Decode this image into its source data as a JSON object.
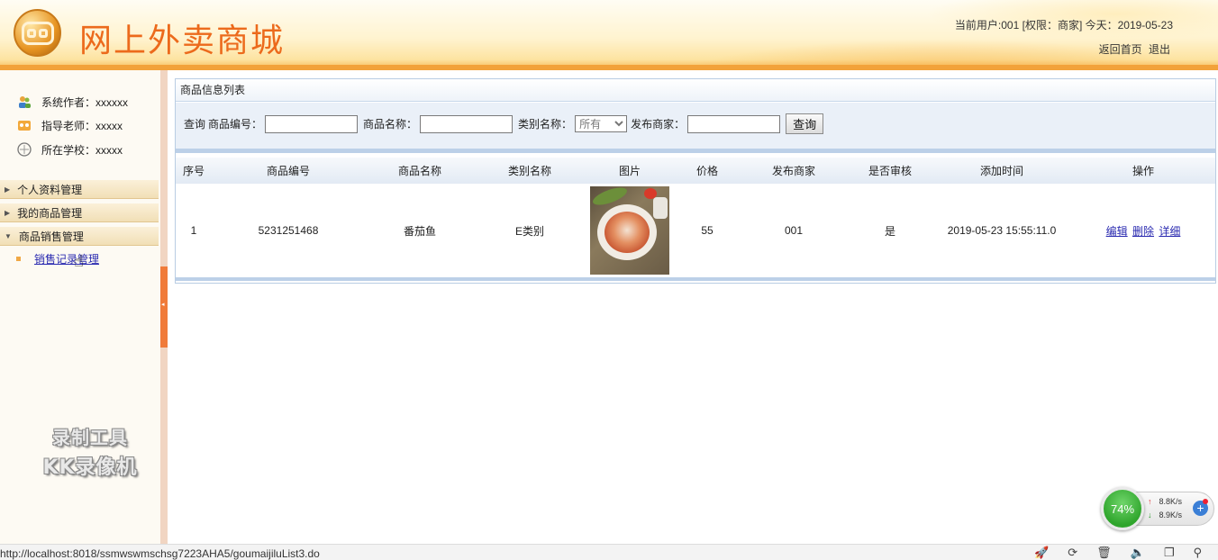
{
  "header": {
    "site_title": "网上外卖商城",
    "user_info": "当前用户:001 [权限：商家] 今天：2019-05-23",
    "links": {
      "home": "返回首页",
      "logout": "退出"
    }
  },
  "sidebar": {
    "info": {
      "author": "系统作者：xxxxxx",
      "teacher": "指导老师：xxxxx",
      "school": "所在学校：xxxxx"
    },
    "groups": [
      {
        "label": "个人资料管理"
      },
      {
        "label": "我的商品管理"
      },
      {
        "label": "商品销售管理"
      }
    ],
    "submenu_item": "销售记录管理",
    "watermark": {
      "line1": "录制工具",
      "line2": "KK录像机"
    }
  },
  "panel": {
    "title": "商品信息列表",
    "search": {
      "query_label": "查询",
      "product_no_label": "商品编号：",
      "product_name_label": "商品名称：",
      "category_label": "类别名称：",
      "category_value": "所有",
      "seller_label": "发布商家：",
      "button": "查询"
    },
    "table": {
      "headers": [
        "序号",
        "商品编号",
        "商品名称",
        "类别名称",
        "图片",
        "价格",
        "发布商家",
        "是否审核",
        "添加时间",
        "操作"
      ],
      "rows": [
        {
          "index": "1",
          "product_no": "5231251468",
          "name": "番茄鱼",
          "category": "E类别",
          "price": "55",
          "seller": "001",
          "approved": "是",
          "added": "2019-05-23 15:55:11.0",
          "actions": {
            "edit": "编辑",
            "delete": "删除",
            "detail": "详细"
          }
        }
      ]
    }
  },
  "statusbar": {
    "url": "http://localhost:8018/ssmwswmschsg7223AHA5/goumaijiluList3.do"
  },
  "netwidget": {
    "percent": "74%",
    "up": "8.8K/s",
    "down": "8.9K/s"
  }
}
